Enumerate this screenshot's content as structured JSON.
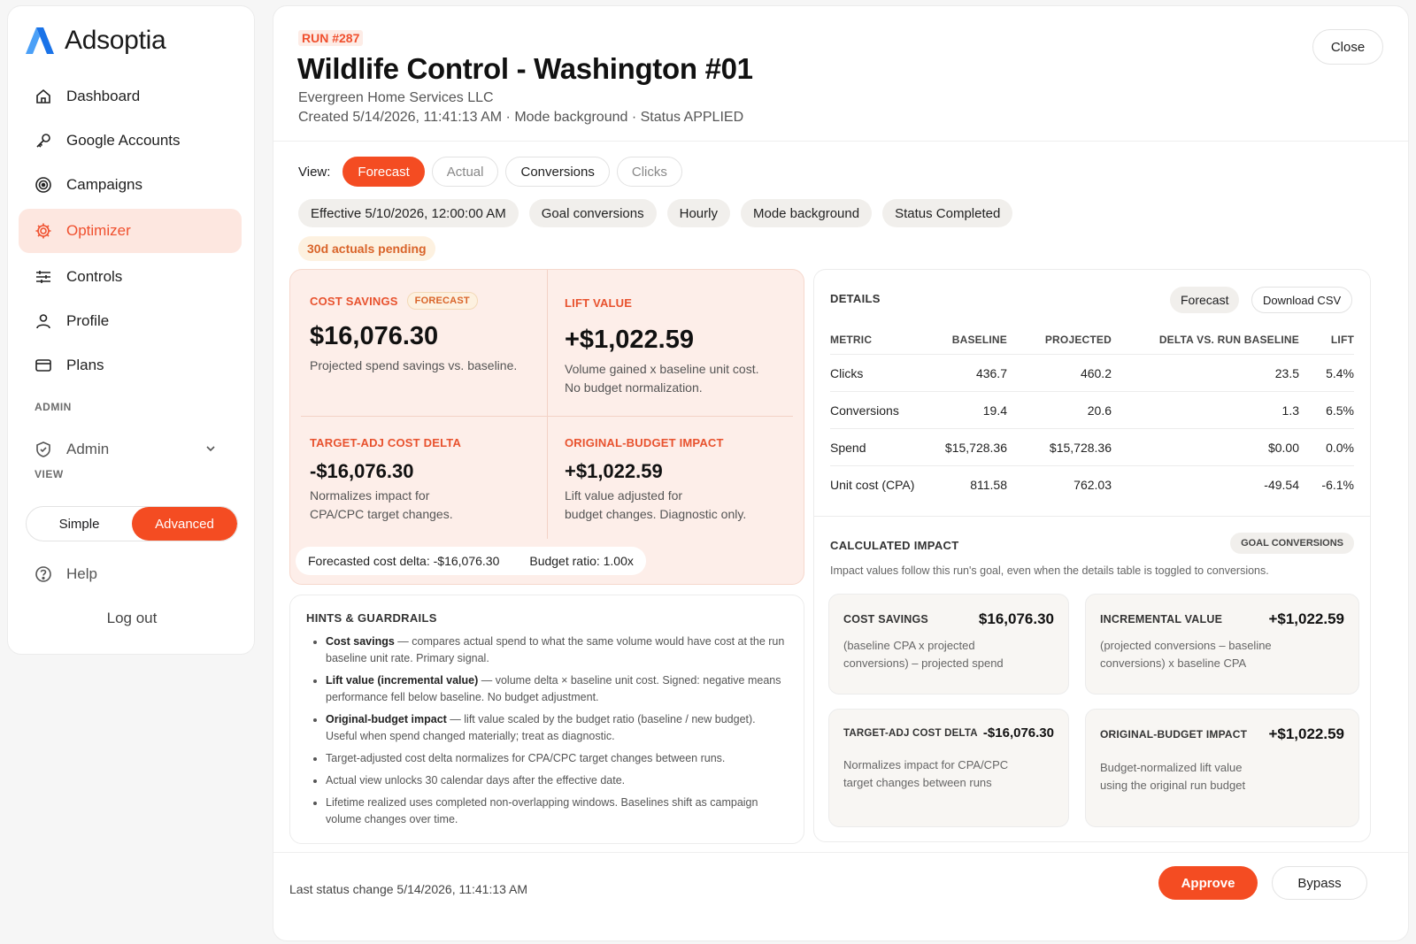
{
  "brand": {
    "name": "Adsoptia",
    "color": "#1a73e8"
  },
  "colors": {
    "accent": "#f44c22",
    "accent_bg": "#fde7e0",
    "pending": "#d9642a"
  },
  "sidebar": {
    "items": [
      {
        "label": "Dashboard",
        "icon": "home-icon"
      },
      {
        "label": "Google Accounts",
        "icon": "key-icon"
      },
      {
        "label": "Campaigns",
        "icon": "target-icon"
      },
      {
        "label": "Optimizer",
        "icon": "gear-icon",
        "active": true
      },
      {
        "label": "Controls",
        "icon": "sliders-icon"
      },
      {
        "label": "Profile",
        "icon": "user-icon"
      },
      {
        "label": "Plans",
        "icon": "card-icon"
      }
    ],
    "admin_section": "ADMIN",
    "admin_label": "Admin",
    "view_section": "VIEW",
    "view_simple": "Simple",
    "view_advanced": "Advanced",
    "view_selected": "Advanced",
    "help": "Help",
    "logout": "Log out"
  },
  "header": {
    "run": "RUN #287",
    "title": "Wildlife Control - Washington #01",
    "company": "Evergreen Home Services LLC",
    "meta": "Created 5/14/2026, 11:41:13 AM · Mode background · Status APPLIED",
    "close": "Close"
  },
  "view": {
    "label": "View:",
    "options": [
      "Forecast",
      "Actual",
      "Conversions",
      "Clicks"
    ],
    "selected": "Forecast"
  },
  "chips": [
    "Effective 5/10/2026, 12:00:00 AM",
    "Goal conversions",
    "Hourly",
    "Mode background",
    "Status Completed"
  ],
  "pending": "30d actuals pending",
  "kpi": {
    "cost_savings": {
      "label": "COST SAVINGS",
      "tag": "FORECAST",
      "value": "$16,076.30",
      "desc": "Projected spend savings vs. baseline."
    },
    "lift_value": {
      "label": "LIFT VALUE",
      "value": "+$1,022.59",
      "desc1": "Volume gained x baseline unit cost.",
      "desc2": "No budget normalization."
    },
    "target_adj": {
      "label": "TARGET-ADJ COST DELTA",
      "value": "-$16,076.30",
      "desc1": "Normalizes impact for",
      "desc2": "CPA/CPC target changes."
    },
    "original_budget": {
      "label": "ORIGINAL-BUDGET IMPACT",
      "value": "+$1,022.59",
      "desc1": "Lift value adjusted for",
      "desc2": "budget changes. Diagnostic only."
    },
    "foot_delta": "Forecasted cost delta: -$16,076.30",
    "foot_ratio": "Budget ratio: 1.00x"
  },
  "hints": {
    "title": "HINTS & GUARDRAILS",
    "items": [
      {
        "bold": "Cost savings",
        "text": " — compares actual spend to what the same volume would have cost at the run baseline unit rate. Primary signal."
      },
      {
        "bold": "Lift value (incremental value)",
        "text": " — volume delta × baseline unit cost. Signed: negative means performance fell below baseline. No budget adjustment."
      },
      {
        "bold": "Original-budget impact",
        "text": " — lift value scaled by the budget ratio (baseline / new budget). Useful when spend changed materially; treat as diagnostic."
      },
      {
        "bold": "",
        "text": "Target-adjusted cost delta normalizes for CPA/CPC target changes between runs."
      },
      {
        "bold": "",
        "text": "Actual view unlocks 30 calendar days after the effective date."
      },
      {
        "bold": "",
        "text": "Lifetime realized uses completed non-overlapping windows. Baselines shift as campaign volume changes over time."
      }
    ]
  },
  "details": {
    "title": "DETAILS",
    "forecast_btn": "Forecast",
    "download_btn": "Download CSV",
    "columns": [
      "METRIC",
      "BASELINE",
      "PROJECTED",
      "DELTA VS. RUN BASELINE",
      "LIFT"
    ],
    "rows": [
      [
        "Clicks",
        "436.7",
        "460.2",
        "23.5",
        "5.4%"
      ],
      [
        "Conversions",
        "19.4",
        "20.6",
        "1.3",
        "6.5%"
      ],
      [
        "Spend",
        "$15,728.36",
        "$15,728.36",
        "$0.00",
        "0.0%"
      ],
      [
        "Unit cost (CPA)",
        "811.58",
        "762.03",
        "-49.54",
        "-6.1%"
      ]
    ]
  },
  "impact": {
    "title": "CALCULATED IMPACT",
    "tag": "GOAL CONVERSIONS",
    "note": "Impact values follow this run's goal, even when the details table is toggled to conversions.",
    "cards": [
      {
        "label": "COST SAVINGS",
        "value": "$16,076.30",
        "desc1": "(baseline CPA x projected",
        "desc2": "conversions) – projected spend"
      },
      {
        "label": "INCREMENTAL VALUE",
        "value": "+$1,022.59",
        "desc1": "(projected conversions – baseline",
        "desc2": "conversions) x baseline CPA"
      },
      {
        "label": "TARGET-ADJ COST DELTA",
        "value": "-$16,076.30",
        "desc1": "Normalizes impact for CPA/CPC",
        "desc2": "target changes between runs"
      },
      {
        "label": "ORIGINAL-BUDGET IMPACT",
        "value": "+$1,022.59",
        "desc1": "Budget-normalized lift value",
        "desc2": "using the original run budget"
      }
    ]
  },
  "footer": {
    "status": "Last status change 5/14/2026, 11:41:13 AM",
    "approve": "Approve",
    "bypass": "Bypass"
  }
}
